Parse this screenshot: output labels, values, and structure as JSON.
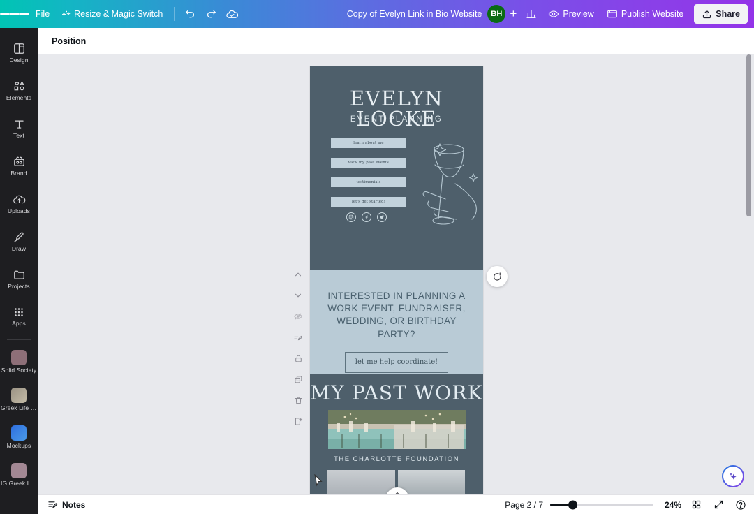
{
  "topbar": {
    "menu_icon": "hamburger-icon",
    "file_label": "File",
    "resize_label": "Resize & Magic Switch",
    "resize_icon": "magic-wand-icon",
    "undo_icon": "undo-icon",
    "redo_icon": "redo-icon",
    "cloud_icon": "cloud-saved-icon",
    "doc_title": "Copy of Evelyn Link in Bio Website",
    "avatar_initials": "BH",
    "add_collaborator_icon": "plus-icon",
    "insights_icon": "bar-chart-icon",
    "preview_icon": "eye-icon",
    "preview_label": "Preview",
    "publish_icon": "window-icon",
    "publish_label": "Publish Website",
    "share_icon": "share-upload-icon",
    "share_label": "Share"
  },
  "sidebar": {
    "items": [
      {
        "label": "Design",
        "icon": "design-panel-icon"
      },
      {
        "label": "Elements",
        "icon": "elements-shapes-icon"
      },
      {
        "label": "Text",
        "icon": "text-t-icon"
      },
      {
        "label": "Brand",
        "icon": "brand-kit-icon"
      },
      {
        "label": "Uploads",
        "icon": "upload-cloud-icon"
      },
      {
        "label": "Draw",
        "icon": "draw-pen-icon"
      },
      {
        "label": "Projects",
        "icon": "projects-folder-icon"
      },
      {
        "label": "Apps",
        "icon": "apps-grid-icon"
      }
    ],
    "recent": [
      {
        "label": "Solid Society",
        "icon": "thumbnail-icon",
        "color": "#8e6f78"
      },
      {
        "label": "Greek Life P...",
        "icon": "thumbnail-icon",
        "color": "#9a9284"
      },
      {
        "label": "Mockups",
        "icon": "thumbnail-icon",
        "color": "#2f6fe0"
      },
      {
        "label": "IG Greek Lif...",
        "icon": "thumbnail-icon",
        "color": "#a38894"
      }
    ]
  },
  "toolbar": {
    "position_label": "Position"
  },
  "floating_tools": [
    {
      "name": "move-up-icon",
      "label": "Move up"
    },
    {
      "name": "move-down-icon",
      "label": "Move down"
    },
    {
      "name": "hide-eye-icon",
      "label": "Hide"
    },
    {
      "name": "notes-icon",
      "label": "Notes"
    },
    {
      "name": "lock-icon",
      "label": "Lock"
    },
    {
      "name": "duplicate-icon",
      "label": "Duplicate"
    },
    {
      "name": "trash-icon",
      "label": "Delete"
    },
    {
      "name": "add-page-icon",
      "label": "Add page"
    }
  ],
  "canvas": {
    "timer_icon": "add-timing-icon",
    "collapse_icon": "chevron-up-icon",
    "ai_icon": "sparkle-ai-icon"
  },
  "design": {
    "colors": {
      "hero_bg": "#4e5f6b",
      "mid_bg": "#b9cbd6",
      "work_bg": "#4e5f6b",
      "button_bg": "#c2d2dc",
      "light_text": "#e7eef2"
    },
    "hero": {
      "title": "EVELYN LOCKE",
      "subtitle": "EVENT PLANNING",
      "buttons": [
        "learn about me",
        "view my past events",
        "testimonials",
        "let's get started!"
      ],
      "socials": [
        {
          "name": "instagram-icon",
          "glyph": "□"
        },
        {
          "name": "facebook-icon",
          "glyph": "f"
        },
        {
          "name": "twitter-icon",
          "glyph": "✈"
        }
      ],
      "illustration": "wine-glass-line-art"
    },
    "middle": {
      "heading": "INTERESTED IN PLANNING A WORK EVENT, FUNDRAISER, WEDDING, OR BIRTHDAY PARTY?",
      "cta_label": "let me help coordinate!"
    },
    "work": {
      "title": "MY PAST WORK",
      "caption": "THE CHARLOTTE FOUNDATION"
    }
  },
  "bottombar": {
    "notes_icon": "notes-icon",
    "notes_label": "Notes",
    "page_label": "Page 2 / 7",
    "zoom_label": "24%",
    "grid_icon": "grid-view-icon",
    "expand_icon": "fullscreen-expand-icon",
    "help_icon": "help-question-icon"
  }
}
